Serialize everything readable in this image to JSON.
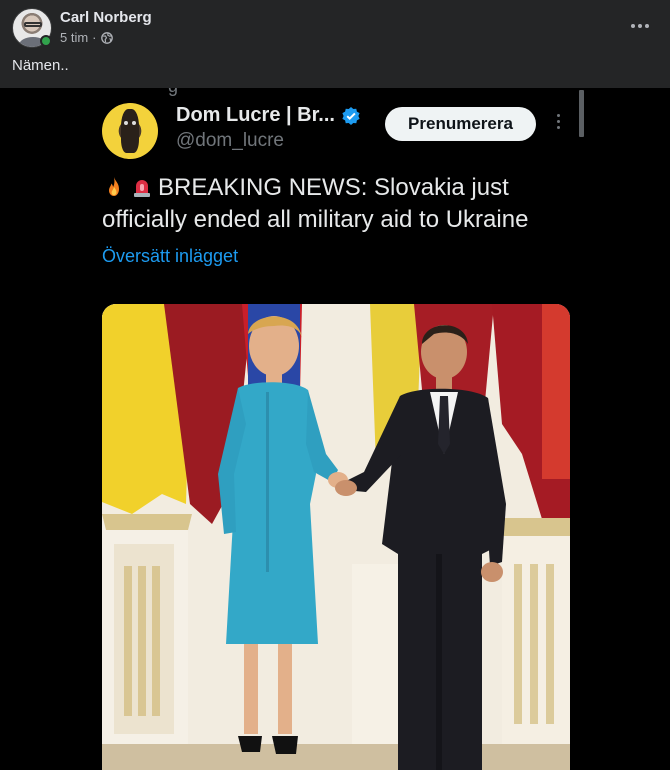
{
  "post": {
    "author_name": "Carl Norberg",
    "time": "5 tim",
    "separator": "·",
    "privacy_icon": "globe-icon",
    "more_icon": "more-horizontal-icon",
    "text": "Nämen.."
  },
  "tweet": {
    "display_name": "Dom Lucre | Br...",
    "handle": "@dom_lucre",
    "verified_icon": "verified-badge-icon",
    "subscribe_label": "Prenumerera",
    "headline_emojis": [
      "fire-icon",
      "siren-icon"
    ],
    "text": "BREAKING NEWS:  Slovakia just officially ended all military aid to Ukraine",
    "translate_label": "Översätt inlägget",
    "top_stub": "g"
  },
  "colors": {
    "background": "#242526",
    "media_background": "#000000",
    "link": "#1d9bf0",
    "online": "#31a24c",
    "dress": "#33a8c8",
    "suit": "#1c1c22"
  }
}
